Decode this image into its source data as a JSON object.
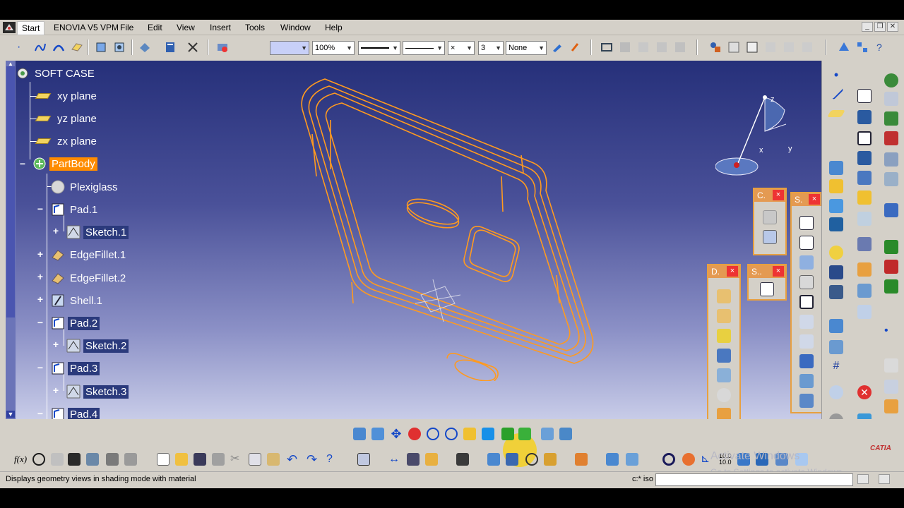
{
  "menu": {
    "start": "Start",
    "items": [
      "ENOVIA V5 VPM",
      "File",
      "Edit",
      "View",
      "Insert",
      "Tools",
      "Window",
      "Help"
    ]
  },
  "toolbar": {
    "zoom_value": "100%",
    "layer_value": "None",
    "line_weight": "3",
    "point_type": "×"
  },
  "tree": {
    "root": "SOFT CASE",
    "planes": [
      "xy plane",
      "yz plane",
      "zx plane"
    ],
    "partbody": "PartBody",
    "nodes": [
      "Plexiglass",
      "Pad.1",
      "Sketch.1",
      "EdgeFillet.1",
      "EdgeFillet.2",
      "Shell.1",
      "Pad.2",
      "Sketch.2",
      "Pad.3",
      "Sketch.3",
      "Pad.4"
    ]
  },
  "compass": {
    "x": "x",
    "y": "y",
    "z": "z"
  },
  "palettes": {
    "c": "C.",
    "s_top": "S.",
    "d": "D.",
    "s_small": "S.."
  },
  "close_glyph": "×",
  "status": {
    "message": "Displays geometry views in shading mode with material",
    "command_label": "c:* iso"
  },
  "watermark": {
    "title": "Activate Windows",
    "subtitle": "Go to Settings to activate Windows."
  },
  "brand": "CATIA",
  "colors": {
    "viewport_top": "#26307a",
    "viewport_bottom": "#c8cce8",
    "wireframe": "#ff9a1f",
    "active_node": "#ff8c00"
  }
}
